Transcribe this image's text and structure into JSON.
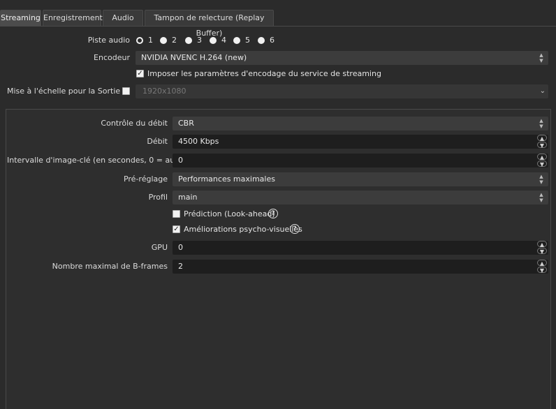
{
  "tabs": [
    {
      "label": "Streaming",
      "active": true
    },
    {
      "label": "Enregistrement"
    },
    {
      "label": "Audio"
    },
    {
      "label": "Tampon de relecture (Replay Buffer)"
    }
  ],
  "audio_track": {
    "label": "Piste audio",
    "options": [
      "1",
      "2",
      "3",
      "4",
      "5",
      "6"
    ],
    "selected": "1"
  },
  "encoder": {
    "label": "Encodeur",
    "value": "NVIDIA NVENC H.264 (new)"
  },
  "enforce_service": {
    "label": "Imposer les paramètres d'encodage du service de streaming",
    "checked": true
  },
  "rescale": {
    "label": "Mise à l'échelle pour la Sortie",
    "checked": false,
    "value": "1920x1080"
  },
  "settings": {
    "rate_control": {
      "label": "Contrôle du débit",
      "value": "CBR"
    },
    "bitrate": {
      "label": "Débit",
      "value": "4500 Kbps"
    },
    "keyframe": {
      "label": "Intervalle d'image-clé (en secondes, 0 = auto)",
      "value": "0"
    },
    "preset": {
      "label": "Pré-réglage",
      "value": "Performances maximales"
    },
    "profile": {
      "label": "Profil",
      "value": "main"
    },
    "lookahead": {
      "label": "Prédiction (Look-ahead)",
      "checked": false
    },
    "psycho_visual": {
      "label": "Améliorations psycho-visuelles",
      "checked": true
    },
    "gpu": {
      "label": "GPU",
      "value": "0"
    },
    "bframes": {
      "label": "Nombre maximal de B-frames",
      "value": "2"
    }
  }
}
